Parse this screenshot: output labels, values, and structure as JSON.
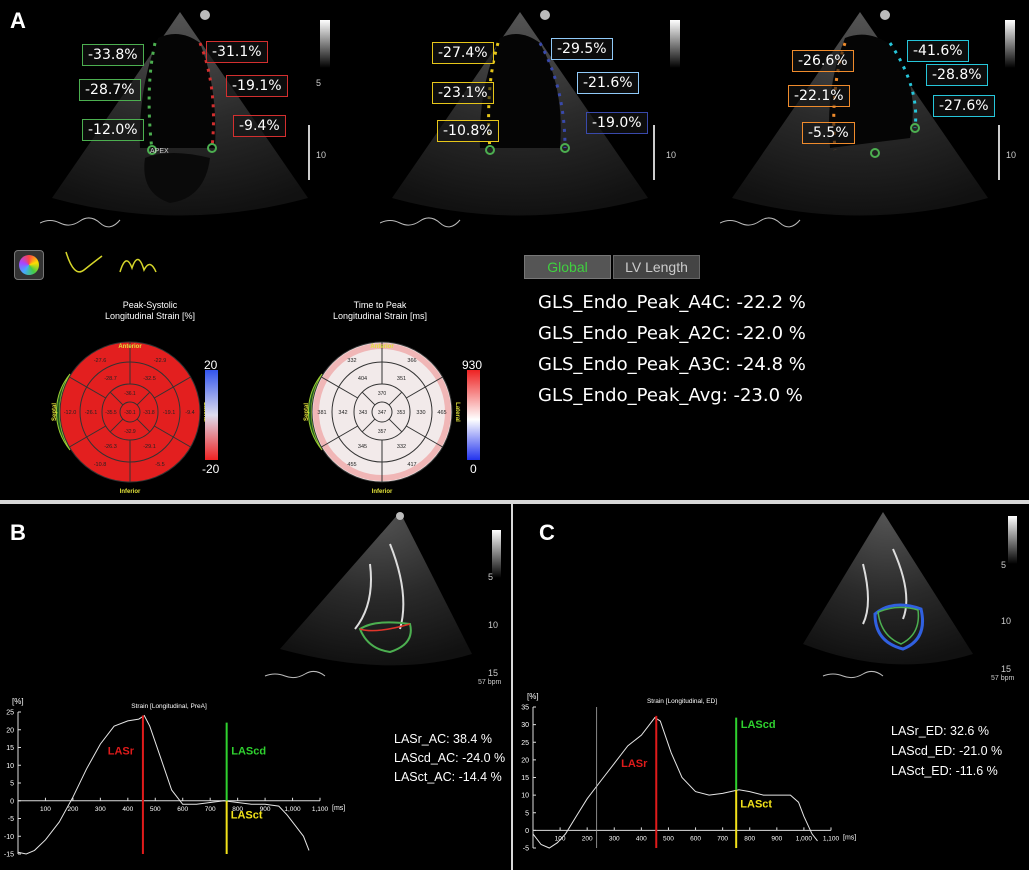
{
  "panels": {
    "A": "A",
    "B": "B",
    "C": "C"
  },
  "panelA": {
    "views": [
      {
        "labels_left": [
          "-33.8%",
          "-28.7%",
          "-12.0%"
        ],
        "labels_right": [
          "-31.1%",
          "-19.1%",
          "-9.4%"
        ],
        "left_color": "#4caf50",
        "right_color": "#d32f2f"
      },
      {
        "labels_left": [
          "-27.4%",
          "-23.1%",
          "-10.8%"
        ],
        "labels_right": [
          "-29.5%",
          "-21.6%",
          "-19.0%"
        ],
        "left_color": "#e6c619",
        "right_color": "#3949ab"
      },
      {
        "labels_left": [
          "-26.6%",
          "-22.1%",
          "-5.5%"
        ],
        "labels_right": [
          "-41.6%",
          "-28.8%",
          "-27.6%"
        ],
        "left_color": "#ef8b2c",
        "right_color": "#26c6da"
      }
    ],
    "scale_numbers": {
      "five": "5",
      "ten": "10"
    },
    "tabs": {
      "global": "Global",
      "lv_length": "LV Length"
    },
    "gls": {
      "a4c": "GLS_Endo_Peak_A4C: -22.2 %",
      "a2c": "GLS_Endo_Peak_A2C: -22.0 %",
      "a3c": "GLS_Endo_Peak_A3C: -24.8 %",
      "avg": "GLS_Endo_Peak_Avg: -23.0 %"
    },
    "bullseye_strain": {
      "title1": "Peak-Systolic",
      "title2": "Longitudinal Strain [%]",
      "scale_max": "20",
      "scale_min": "-20",
      "anterior": "Anterior",
      "inferior": "Inferior",
      "septal": "Septal",
      "lateral": "Lateral",
      "values": {
        "basal": [
          "-22.9",
          "-9.4",
          "-5.5",
          "-10.8",
          "-12.0",
          "-27.6"
        ],
        "mid": [
          "-32.5",
          "-19.1",
          "-29.1",
          "-26.3",
          "-26.1",
          "-28.7"
        ],
        "apical": [
          "-36.1",
          "-31.8",
          "-32.9",
          "-35.5"
        ],
        "apex": "-30.1"
      }
    },
    "bullseye_time": {
      "title1": "Time to Peak",
      "title2": "Longitudinal Strain [ms]",
      "scale_max": "930",
      "scale_min": "0",
      "anterior": "Anterior",
      "inferior": "Inferior",
      "septal": "Septal",
      "lateral": "Lateral",
      "values": {
        "basal": [
          "366",
          "465",
          "417",
          "455",
          "381",
          "332"
        ],
        "mid": [
          "351",
          "330",
          "332",
          "345",
          "342",
          "404"
        ],
        "apical": [
          "370",
          "353",
          "357",
          "343"
        ],
        "apex": "347"
      }
    }
  },
  "panelB": {
    "chart_title": "Strain [Longitudinal, PreA]",
    "y_unit": "[%]",
    "x_unit": "[ms]",
    "y_ticks": [
      "25",
      "20",
      "15",
      "10",
      "5",
      "0",
      "-5",
      "-10",
      "-15"
    ],
    "x_ticks": [
      "100",
      "200",
      "300",
      "400",
      "500",
      "600",
      "700",
      "800",
      "900",
      "1,000",
      "1,100"
    ],
    "lasr": "LASr",
    "lascd": "LAScd",
    "lasct": "LASct",
    "measures": [
      "LASr_AC: 38.4 %",
      "LAScd_AC: -24.0 %",
      "LASct_AC: -14.4 %"
    ],
    "bpm": "57 bpm",
    "scale": {
      "five": "5",
      "ten": "10",
      "fifteen": "15"
    }
  },
  "panelC": {
    "chart_title": "Strain [Longitudinal, ED]",
    "y_unit": "[%]",
    "x_unit": "[ms]",
    "y_ticks": [
      "35",
      "30",
      "25",
      "20",
      "15",
      "10",
      "5",
      "0",
      "-5"
    ],
    "x_ticks": [
      "100",
      "200",
      "300",
      "400",
      "500",
      "600",
      "700",
      "800",
      "900",
      "1,000",
      "1,100"
    ],
    "lasr": "LASr",
    "lascd": "LAScd",
    "lasct": "LASct",
    "measures": [
      "LASr_ED: 32.6 %",
      "LAScd_ED: -21.0 %",
      "LASct_ED: -11.6 %"
    ],
    "bpm": "57 bpm",
    "scale": {
      "five": "5",
      "ten": "10",
      "fifteen": "15"
    }
  },
  "colors": {
    "lasr": "#e01b1b",
    "lascd": "#2fd12f",
    "lasct": "#f2e21a",
    "global_tab_text": "#3fd13f"
  }
}
